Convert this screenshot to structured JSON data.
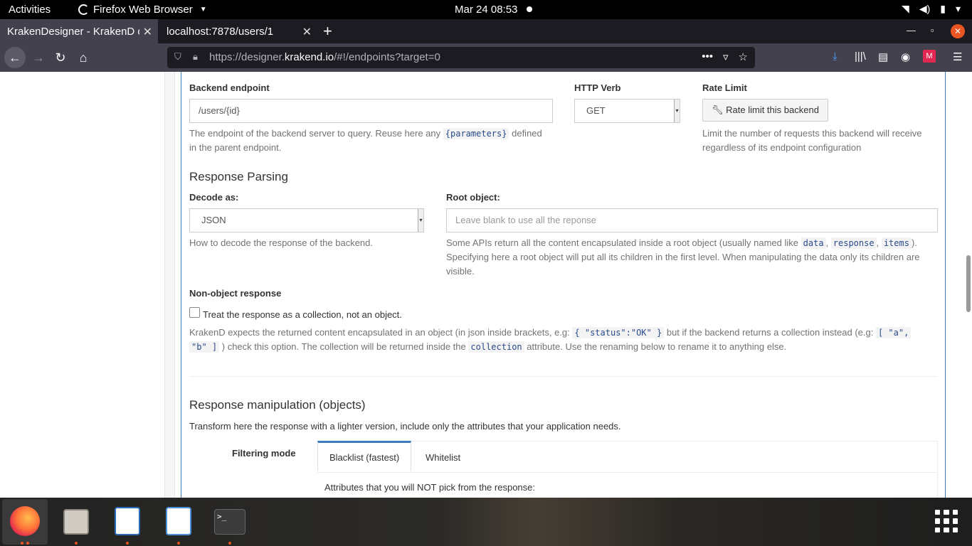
{
  "topbar": {
    "activities": "Activities",
    "app_name": "Firefox Web Browser",
    "clock": "Mar 24  08:53"
  },
  "browser": {
    "tabs": [
      {
        "title": "KrakenDesigner - KrakenD c",
        "active": true
      },
      {
        "title": "localhost:7878/users/1",
        "active": false
      }
    ],
    "url_prefix": "https://designer.",
    "url_domain": "krakend.io",
    "url_suffix": "/#!/endpoints?target=0"
  },
  "backend": {
    "endpoint_label": "Backend endpoint",
    "endpoint_value": "/users/{id}",
    "endpoint_help_1": "The endpoint of the backend server to query. Reuse here any",
    "endpoint_help_code": "{parameters}",
    "endpoint_help_2": "defined",
    "endpoint_help_3": "in the parent endpoint.",
    "verb_label": "HTTP Verb",
    "verb_value": "GET",
    "rate_label": "Rate Limit",
    "rate_button": "Rate limit this backend",
    "rate_help_1": "Limit the number of requests this backend will receive",
    "rate_help_2": "regardless of its endpoint configuration"
  },
  "parsing": {
    "title": "Response Parsing",
    "decode_label": "Decode as:",
    "decode_value": "JSON",
    "decode_help": "How to decode the response of the backend.",
    "root_label": "Root object:",
    "root_placeholder": "Leave blank to use all the reponse",
    "root_help_1": "Some APIs return all the content encapsulated inside a root object (usually named like",
    "root_code_1": "data",
    "root_code_2": "response",
    "root_code_3": "items",
    "root_help_2": "Specifying here a root object will put all its children in the first level. When manipulating the data only its children are",
    "root_help_3": "visible."
  },
  "nonobject": {
    "label": "Non-object response",
    "checkbox_label": "Treat the response as a collection, not an object.",
    "help_1": "KrakenD expects the returned content encapsulated in an object (in json inside brackets, e.g:",
    "help_code_1": "{ \"status\":\"OK\" }",
    "help_2": "but if the backend returns a collection instead (e.g:",
    "help_code_2a": "[ \"a\",",
    "help_code_2b": "\"b\" ]",
    "help_3": ") check this option. The collection will be returned inside the",
    "help_code_3": "collection",
    "help_4": "attribute. Use the renaming below to rename it to anything else."
  },
  "manipulation": {
    "title": "Response manipulation (objects)",
    "subtitle": "Transform here the response with a lighter version, include only the attributes that your application needs.",
    "filter_label": "Filtering mode",
    "tab_blacklist": "Blacklist (fastest)",
    "tab_whitelist": "Whitelist",
    "blacklist_help": "Attributes that you will NOT pick from the response:"
  },
  "colors": {
    "accent": "#3a7ebf",
    "code_text": "#2a4b8d",
    "ubuntu_orange": "#e95420"
  }
}
